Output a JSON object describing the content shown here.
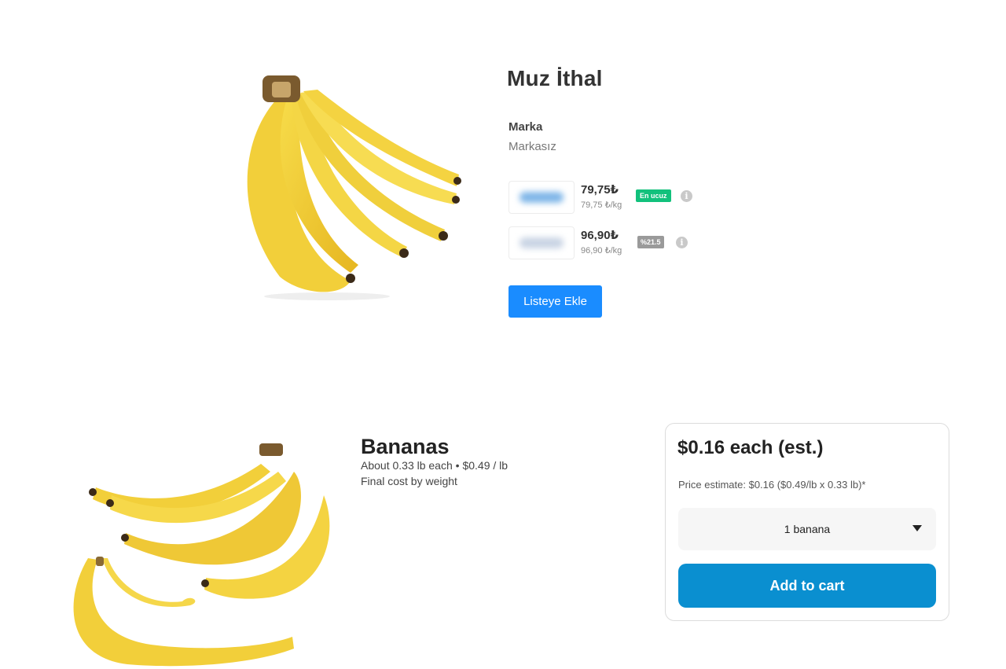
{
  "product_tr": {
    "title": "Muz İthal",
    "brand_label": "Marka",
    "brand_value": "Markasız",
    "offers": [
      {
        "price": "79,75₺",
        "unit_price": "79,75 ₺/kg",
        "badge": "En ucuz",
        "badge_color": "#12c17c"
      },
      {
        "price": "96,90₺",
        "unit_price": "96,90 ₺/kg",
        "badge": "%21.5",
        "badge_color": "#9a9a9a"
      }
    ],
    "add_to_list_label": "Listeye Ekle",
    "button_color": "#1a8cff"
  },
  "product_en": {
    "title": "Bananas",
    "weight_each": "About 0.33 lb each",
    "price_per_lb": "• $0.49 / lb",
    "note": "Final cost by weight",
    "price_each": "$0.16 each (est.)",
    "price_estimate": "Price estimate: $0.16 ($0.49/lb x 0.33 lb)*",
    "quantity_selected": "1 banana",
    "add_to_cart_label": "Add to cart",
    "button_color": "#0a8fd0"
  },
  "icons": {
    "info": "info-icon",
    "caret": "chevron-down-icon"
  }
}
